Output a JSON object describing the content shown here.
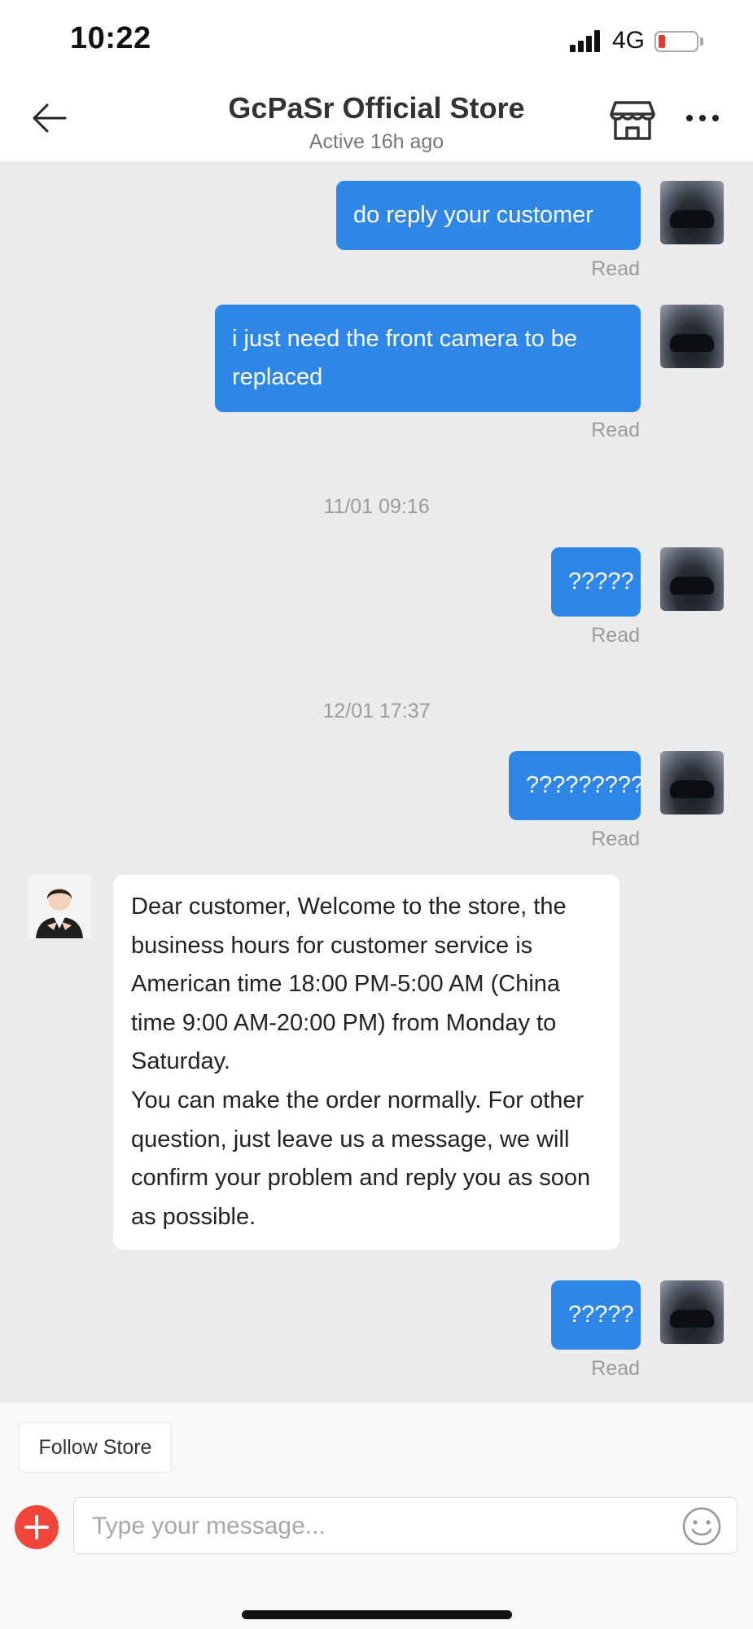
{
  "status_bar": {
    "time": "10:22",
    "network": "4G",
    "battery_level_pct": 10
  },
  "header": {
    "title": "GcPaSr Official Store",
    "subtitle": "Active 16h ago"
  },
  "messages": [
    {
      "text": "do reply your customer",
      "status": "Read"
    },
    {
      "text": "i just need the front camera to be replaced",
      "status": "Read"
    },
    {
      "text": "?????",
      "status": "Read"
    },
    {
      "text": "?????????",
      "status": "Read"
    },
    {
      "text": "?????",
      "status": "Read"
    }
  ],
  "timestamps": [
    "11/01 09:16",
    "12/01 17:37"
  ],
  "store_reply": "Dear customer,  Welcome to the store, the business hours for customer service is American time 18:00 PM-5:00 AM (China time 9:00 AM-20:00 PM) from Monday to Saturday.\nYou can make the order normally. For other question,  just leave us a message, we will confirm your problem and reply you as soon as possible.",
  "bottom": {
    "follow_label": "Follow Store",
    "input_placeholder": "Type your message..."
  },
  "colors": {
    "outgoing_bubble": "#2e87e6",
    "plus_button": "#f0463a",
    "chat_background": "#ebebeb"
  },
  "icons": [
    "back-arrow-icon",
    "store-icon",
    "more-icon",
    "plus-icon",
    "emoji-icon"
  ]
}
